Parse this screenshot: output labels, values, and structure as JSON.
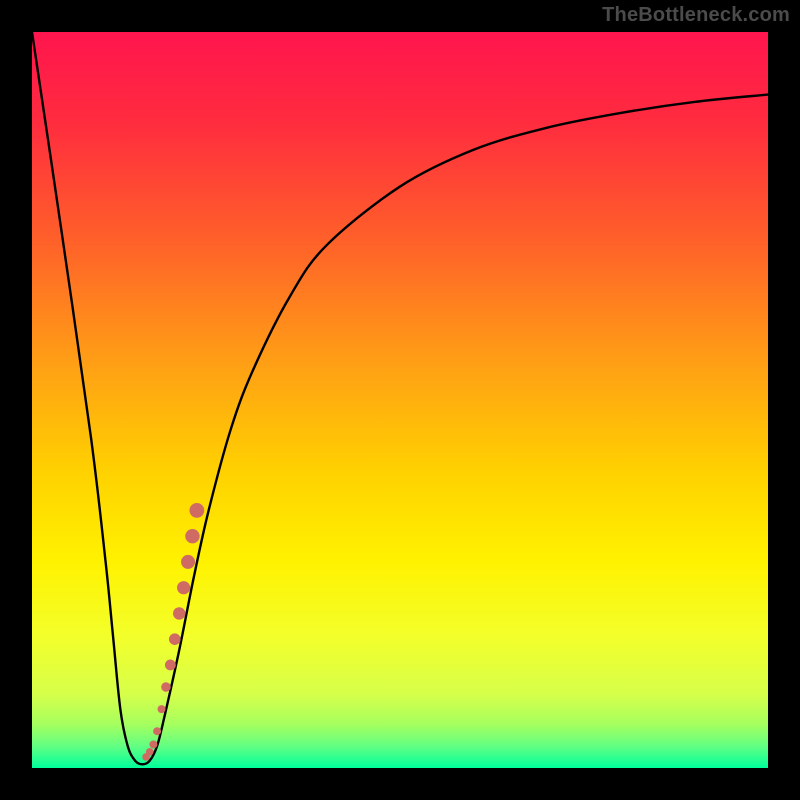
{
  "watermark": "TheBottleneck.com",
  "colors": {
    "frame": "#000000",
    "gradient_stops": [
      {
        "offset": 0.0,
        "color": "#ff154e"
      },
      {
        "offset": 0.12,
        "color": "#ff2b3f"
      },
      {
        "offset": 0.28,
        "color": "#ff5f2a"
      },
      {
        "offset": 0.45,
        "color": "#ff9f15"
      },
      {
        "offset": 0.6,
        "color": "#ffd200"
      },
      {
        "offset": 0.72,
        "color": "#fff200"
      },
      {
        "offset": 0.82,
        "color": "#f3ff2a"
      },
      {
        "offset": 0.9,
        "color": "#d6ff4a"
      },
      {
        "offset": 0.94,
        "color": "#a6ff5e"
      },
      {
        "offset": 0.97,
        "color": "#63ff82"
      },
      {
        "offset": 1.0,
        "color": "#00ff9c"
      }
    ],
    "curve": "#000000",
    "dots": "#cf6b63"
  },
  "chart_data": {
    "type": "line",
    "title": "",
    "xlabel": "",
    "ylabel": "",
    "xlim": [
      0,
      100
    ],
    "ylim": [
      0,
      100
    ],
    "x": [
      0,
      4,
      8,
      10,
      11,
      12,
      13,
      14,
      15,
      16,
      17,
      18,
      20,
      22,
      24,
      27,
      30,
      35,
      40,
      50,
      60,
      70,
      80,
      90,
      100
    ],
    "values": [
      100,
      73,
      45,
      28,
      18,
      8,
      3,
      1,
      0.5,
      1,
      3,
      7,
      16,
      26,
      35,
      46,
      54,
      64,
      71,
      79,
      84,
      87,
      89,
      90.5,
      91.5
    ],
    "dot_series": {
      "name": "highlight",
      "x": [
        15.5,
        16.0,
        16.5,
        17.0,
        17.6,
        18.2,
        18.8,
        19.4,
        20.0,
        20.6,
        21.2,
        21.8,
        22.4
      ],
      "y": [
        1.5,
        2.2,
        3.2,
        5.0,
        8.0,
        11.0,
        14.0,
        17.5,
        21.0,
        24.5,
        28.0,
        31.5,
        35.0
      ],
      "r": [
        3.8,
        3.8,
        4.0,
        4.0,
        4.0,
        4.8,
        5.4,
        5.8,
        6.2,
        6.6,
        7.0,
        7.2,
        7.4
      ]
    }
  }
}
